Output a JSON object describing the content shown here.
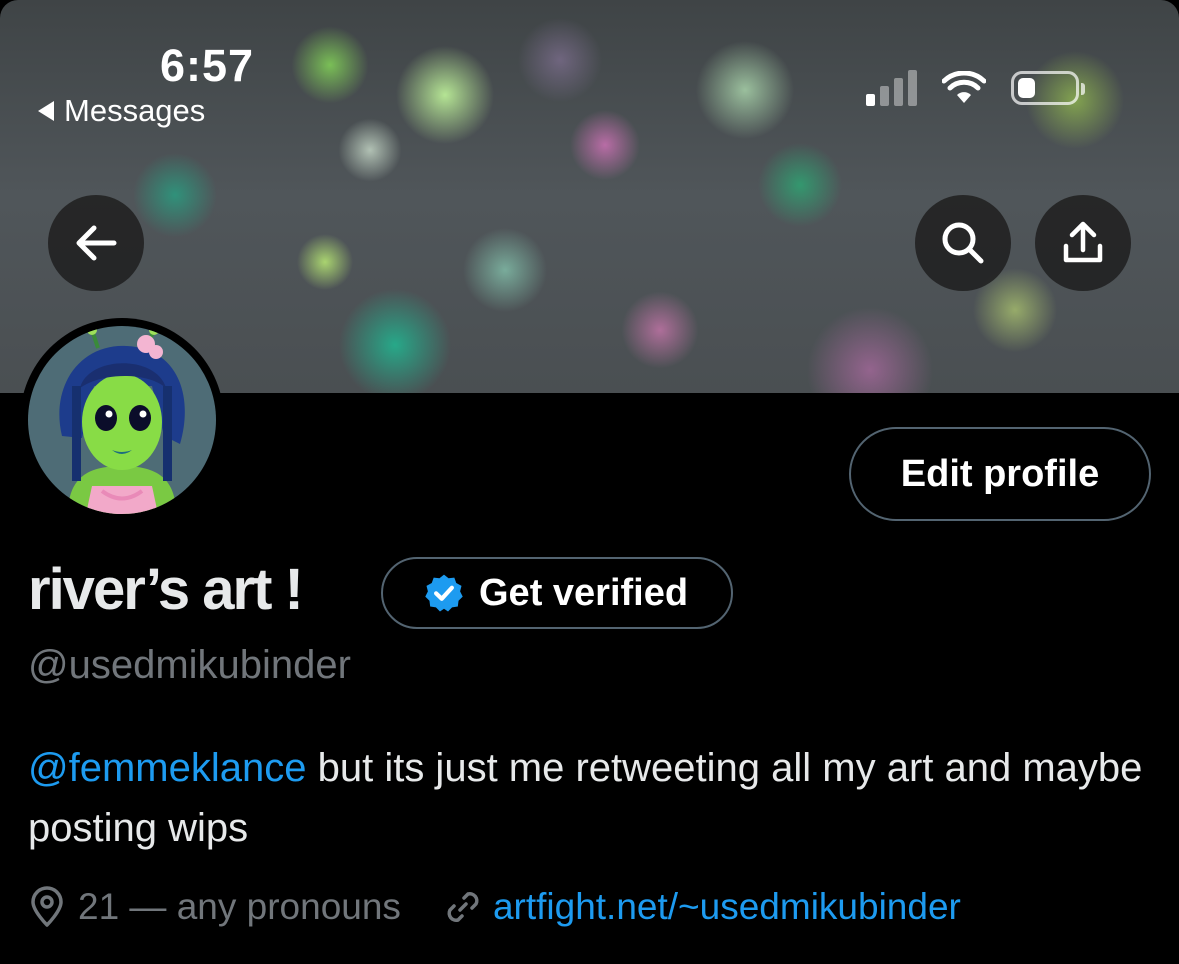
{
  "status_bar": {
    "time": "6:57",
    "back_label": "Messages"
  },
  "profile": {
    "edit_label": "Edit profile",
    "name": "river’s art !",
    "get_verified_label": "Get verified",
    "handle": "@usedmikubinder",
    "bio": {
      "mention": "@femmeklance",
      "text": " but its just me retweeting all my art and maybe posting wips"
    },
    "location": "21 — any pronouns",
    "website": "artfight.net/~usedmikubinder"
  },
  "icons": {
    "back": "arrow-left-icon",
    "search": "search-icon",
    "share": "share-icon",
    "verified": "verified-badge-icon",
    "location": "location-pin-icon",
    "link": "link-icon"
  },
  "colors": {
    "accent": "#1d9bf0",
    "background": "#000000",
    "muted_text": "#71767b",
    "border": "#536471"
  }
}
